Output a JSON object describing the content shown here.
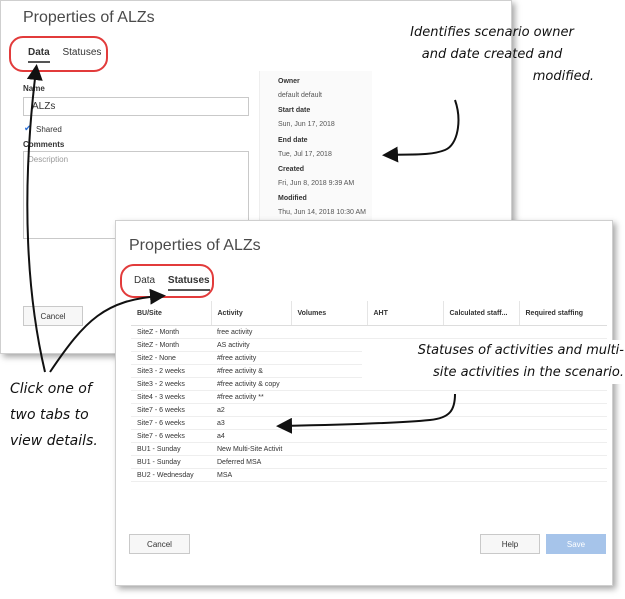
{
  "back_panel": {
    "title": "Properties of ALZs",
    "tabs": [
      "Data",
      "Statuses"
    ],
    "name_label": "Name",
    "name_value": "ALZs",
    "shared_label": "Shared",
    "comments_label": "Comments",
    "description_placeholder": "Description",
    "details": [
      {
        "label": "Owner",
        "value": "default default"
      },
      {
        "label": "Start date",
        "value": "Sun, Jun 17, 2018"
      },
      {
        "label": "End date",
        "value": "Tue, Jul 17, 2018"
      },
      {
        "label": "Created",
        "value": "Fri, Jun 8, 2018 9:39 AM"
      },
      {
        "label": "Modified",
        "value": "Thu, Jun 14, 2018 10:30 AM"
      }
    ],
    "cancel_label": "Cancel"
  },
  "front_panel": {
    "title": "Properties of ALZs",
    "tabs": [
      "Data",
      "Statuses"
    ],
    "columns": [
      "BU/Site",
      "Activity",
      "Volumes",
      "AHT",
      "Calculated staff...",
      "Required staffing"
    ],
    "rows": [
      [
        "SiteZ - Month",
        "free activity"
      ],
      [
        "SiteZ - Month",
        "AS activity"
      ],
      [
        "Site2 - None",
        "#free activity"
      ],
      [
        "Site3 - 2 weeks",
        "#free activity &"
      ],
      [
        "Site3 - 2 weeks",
        "#free activity & copy"
      ],
      [
        "Site4 - 3 weeks",
        "#free activity **"
      ],
      [
        "Site7 - 6 weeks",
        "a2"
      ],
      [
        "Site7 - 6 weeks",
        "a3"
      ],
      [
        "Site7 - 6 weeks",
        "a4"
      ],
      [
        "BU1 - Sunday",
        "New Multi-Site Activit"
      ],
      [
        "BU1 - Sunday",
        "Deferred MSA"
      ],
      [
        "BU2 - Wednesday",
        "MSA"
      ]
    ],
    "cancel_label": "Cancel",
    "help_label": "Help",
    "save_label": "Save"
  },
  "annotations": {
    "owner_note": [
      "Identifies scenario owner",
      "and date created and",
      "modified."
    ],
    "statuses_note": [
      "Statuses of activities and multi-",
      "site activities in the scenario."
    ],
    "tabs_note": [
      "Click one of",
      "two tabs to",
      "view details."
    ]
  },
  "colors": {
    "highlight_oval": "#e23b3b",
    "save_button": "#a6c4ea",
    "checkbox": "#2a6fd6"
  }
}
